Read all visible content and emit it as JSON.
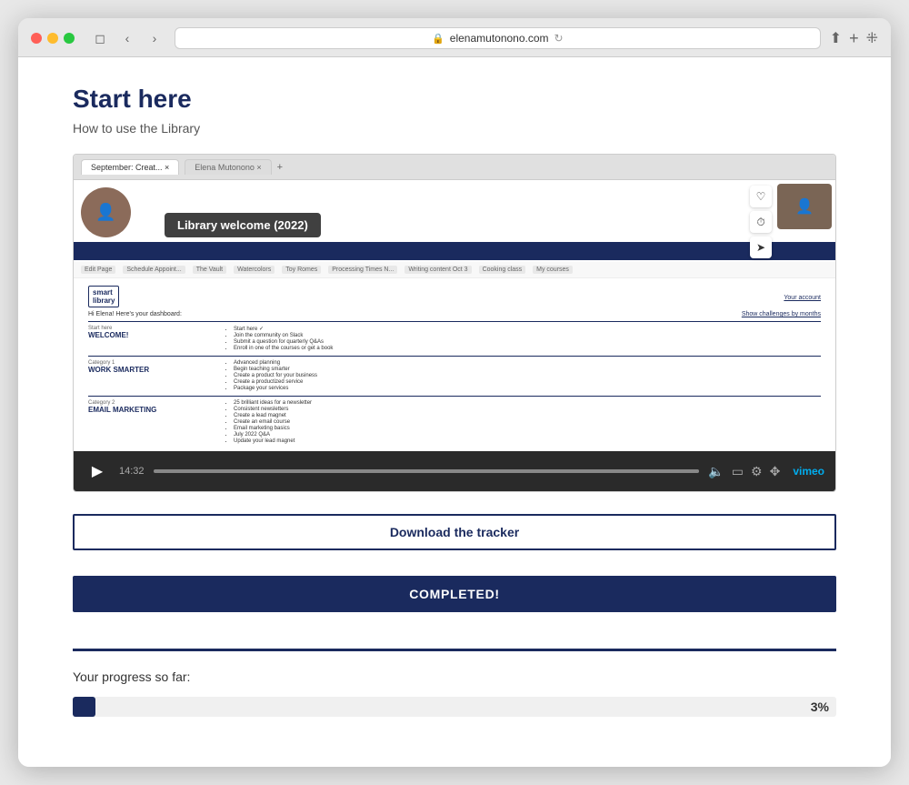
{
  "browser": {
    "url": "elenamutonono.com",
    "tabs": [
      "September: Creat...",
      "Elena Mutonono"
    ]
  },
  "page": {
    "title": "Start here",
    "subtitle": "How to use the Library"
  },
  "video": {
    "overlay_title": "Library welcome (2022)",
    "author": "Elena Mutonono",
    "time_current": "14:32",
    "time_total": "14:32"
  },
  "inner_page": {
    "logo": "smart library",
    "account_link": "Your account",
    "dashboard_greeting": "Hi Elena! Here's your dashboard:",
    "show_challenges": "Show challenges by months",
    "sections": [
      {
        "label": "Start here",
        "title": "WELCOME!",
        "bullets": [
          "Start here ✓",
          "Join the community on Slack",
          "Submit a question for quarterly Q&As",
          "Enroll in one of the courses or get a book"
        ]
      },
      {
        "label": "Category 1",
        "title": "WORK SMARTER",
        "bullets": [
          "Advanced planning",
          "Begin teaching smarter",
          "Create a product for your business",
          "Create a productized service",
          "Package your services"
        ]
      },
      {
        "label": "Category 2",
        "title": "EMAIL MARKETING",
        "bullets": [
          "25 brilliant ideas for a newsletter",
          "Consistent newsletters",
          "Create a lead magnet",
          "Create an email course",
          "Email marketing basics",
          "July 2022 Q&A",
          "Update your lead magnet"
        ]
      }
    ]
  },
  "buttons": {
    "download": "Download the tracker",
    "completed": "COMPLETED!"
  },
  "progress": {
    "label": "Your progress so far:",
    "percent": "3%",
    "percent_value": 3
  }
}
